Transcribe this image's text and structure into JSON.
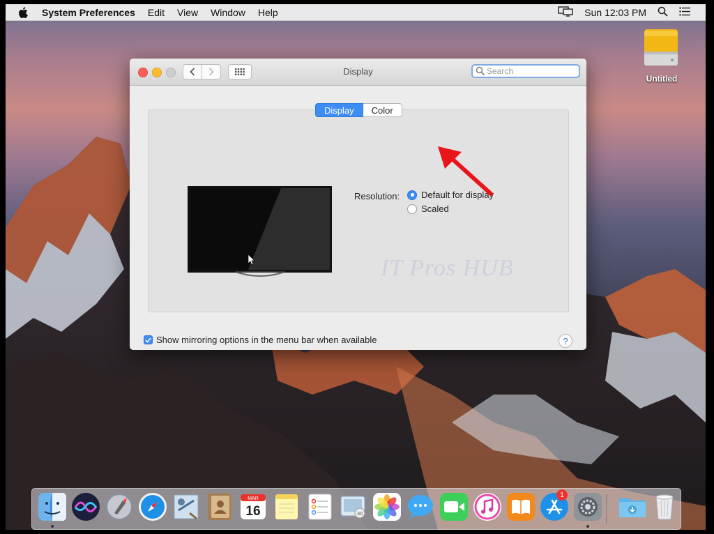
{
  "menubar": {
    "app_name": "System Preferences",
    "items": [
      "Edit",
      "View",
      "Window",
      "Help"
    ],
    "clock": "Sun 12:03 PM"
  },
  "desktop": {
    "drive_label": "Untitled"
  },
  "window": {
    "title": "Display",
    "search_placeholder": "Search",
    "tabs": [
      "Display",
      "Color"
    ],
    "active_tab": "Display",
    "resolution_label": "Resolution:",
    "resolution_options": [
      "Default for display",
      "Scaled"
    ],
    "selected_resolution": "Default for display",
    "watermark": "IT Pros HUB",
    "mirroring_label": "Show mirroring options in the menu bar when available",
    "mirroring_checked": true,
    "help_label": "?"
  },
  "dock": {
    "items": [
      "Finder",
      "Siri",
      "Launchpad",
      "Safari",
      "Mail",
      "Contacts",
      "Calendar",
      "Notes",
      "Reminders",
      "Photo Booth",
      "Photos",
      "Messages",
      "FaceTime",
      "iTunes",
      "iBooks",
      "App Store",
      "System Preferences",
      "Downloads",
      "Trash"
    ],
    "calendar_month": "MAR",
    "calendar_day": "16",
    "app_store_badge": "1"
  },
  "colors": {
    "accent": "#3d8df5",
    "annotation_arrow": "#e8161b"
  }
}
